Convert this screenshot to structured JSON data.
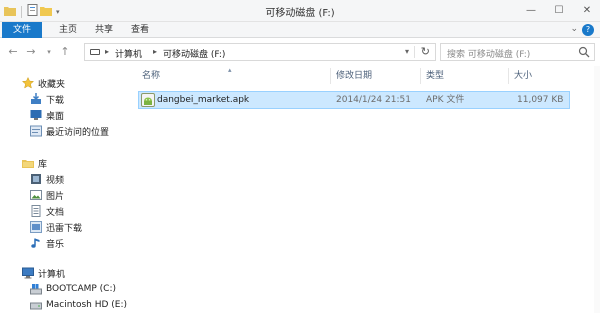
{
  "window": {
    "title": "可移动磁盘 (F:)"
  },
  "ribbon": {
    "tabs": [
      "文件",
      "主页",
      "共享",
      "查看"
    ]
  },
  "address": {
    "crumbs": [
      "计算机",
      "可移动磁盘 (F:)"
    ]
  },
  "search": {
    "placeholder": "搜索 可移动磁盘 (F:)"
  },
  "nav": {
    "favorites": {
      "label": "收藏夹",
      "items": [
        "下载",
        "桌面",
        "最近访问的位置"
      ]
    },
    "libraries": {
      "label": "库",
      "items": [
        "视频",
        "图片",
        "文档",
        "迅雷下载",
        "音乐"
      ]
    },
    "computer": {
      "label": "计算机",
      "items": [
        "BOOTCAMP (C:)",
        "Macintosh HD (E:)"
      ]
    }
  },
  "columns": {
    "name": "名称",
    "modified": "修改日期",
    "type": "类型",
    "size": "大小"
  },
  "files": [
    {
      "name": "dangbei_market.apk",
      "modified": "2014/1/24 21:51",
      "type": "APK 文件",
      "size": "11,097 KB"
    }
  ],
  "colors": {
    "accent": "#1979ca",
    "selection": "#cce8ff",
    "selection_border": "#99d1ff"
  }
}
